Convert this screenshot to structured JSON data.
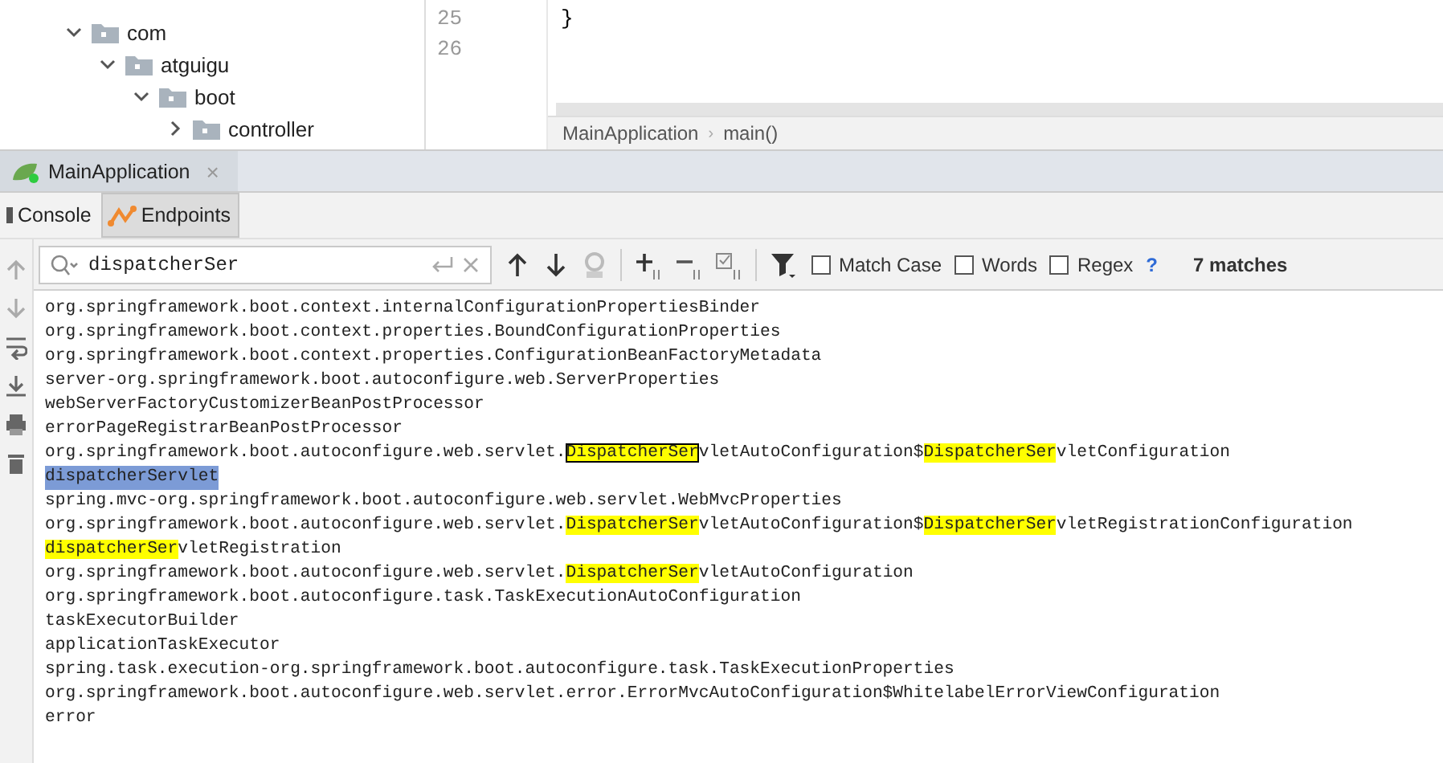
{
  "project_tree": {
    "items": [
      {
        "label": "com",
        "expanded": true,
        "children": [
          {
            "label": "atguigu",
            "expanded": true,
            "children": [
              {
                "label": "boot",
                "expanded": true,
                "children": [
                  {
                    "label": "controller",
                    "expanded": false
                  }
                ]
              }
            ]
          }
        ]
      }
    ]
  },
  "editor": {
    "line_numbers": [
      "25",
      "26"
    ],
    "code_lines": [
      "}"
    ],
    "breadcrumb": [
      "MainApplication",
      "main()"
    ],
    "breadcrumb_separator": "›"
  },
  "run_panel": {
    "tabs": [
      {
        "label": "MainApplication",
        "close": "×",
        "selected": true
      }
    ],
    "sub_tabs": [
      {
        "label": "Console",
        "kind": "console",
        "selected": false
      },
      {
        "label": "Endpoints",
        "kind": "endpoints",
        "selected": true
      }
    ],
    "search": {
      "value": "dispatcherSer",
      "options": [
        {
          "label": "Match Case",
          "checked": false
        },
        {
          "label": "Words",
          "checked": false
        },
        {
          "label": "Regex",
          "checked": false
        }
      ],
      "help": "?",
      "matches": "7 matches"
    },
    "console_lines": [
      {
        "selected": false,
        "segments": [
          {
            "text": "org.springframework.boot.context.internalConfigurationPropertiesBinder",
            "highlighted": false
          }
        ]
      },
      {
        "selected": false,
        "segments": [
          {
            "text": "org.springframework.boot.context.properties.BoundConfigurationProperties",
            "highlighted": false
          }
        ]
      },
      {
        "selected": false,
        "segments": [
          {
            "text": "org.springframework.boot.context.properties.ConfigurationBeanFactoryMetadata",
            "highlighted": false
          }
        ]
      },
      {
        "selected": false,
        "segments": [
          {
            "text": "server-org.springframework.boot.autoconfigure.web.ServerProperties",
            "highlighted": false
          }
        ]
      },
      {
        "selected": false,
        "segments": [
          {
            "text": "webServerFactoryCustomizerBeanPostProcessor",
            "highlighted": false
          }
        ]
      },
      {
        "selected": false,
        "segments": [
          {
            "text": "errorPageRegistrarBeanPostProcessor",
            "highlighted": false
          }
        ]
      },
      {
        "selected": false,
        "segments": [
          {
            "text": "org.springframework.boot.autoconfigure.web.servlet.",
            "highlighted": false
          },
          {
            "text": "DispatcherSer",
            "highlighted": true,
            "current": true
          },
          {
            "text": "vletAutoConfiguration$",
            "highlighted": false
          },
          {
            "text": "DispatcherSer",
            "highlighted": true,
            "current": false
          },
          {
            "text": "vletConfiguration",
            "highlighted": false
          }
        ]
      },
      {
        "selected": true,
        "segments": [
          {
            "text": "dispatcherServlet",
            "highlighted": false
          }
        ]
      },
      {
        "selected": false,
        "segments": [
          {
            "text": "spring.mvc-org.springframework.boot.autoconfigure.web.servlet.WebMvcProperties",
            "highlighted": false
          }
        ]
      },
      {
        "selected": false,
        "segments": [
          {
            "text": "org.springframework.boot.autoconfigure.web.servlet.",
            "highlighted": false
          },
          {
            "text": "DispatcherSer",
            "highlighted": true,
            "current": false
          },
          {
            "text": "vletAutoConfiguration$",
            "highlighted": false
          },
          {
            "text": "DispatcherSer",
            "highlighted": true,
            "current": false
          },
          {
            "text": "vletRegistrationConfiguration",
            "highlighted": false
          }
        ]
      },
      {
        "selected": false,
        "segments": [
          {
            "text": "dispatcherSer",
            "highlighted": true,
            "current": false
          },
          {
            "text": "vletRegistration",
            "highlighted": false
          }
        ]
      },
      {
        "selected": false,
        "segments": [
          {
            "text": "org.springframework.boot.autoconfigure.web.servlet.",
            "highlighted": false
          },
          {
            "text": "DispatcherSer",
            "highlighted": true,
            "current": false
          },
          {
            "text": "vletAutoConfiguration",
            "highlighted": false
          }
        ]
      },
      {
        "selected": false,
        "segments": [
          {
            "text": "org.springframework.boot.autoconfigure.task.TaskExecutionAutoConfiguration",
            "highlighted": false
          }
        ]
      },
      {
        "selected": false,
        "segments": [
          {
            "text": "taskExecutorBuilder",
            "highlighted": false
          }
        ]
      },
      {
        "selected": false,
        "segments": [
          {
            "text": "applicationTaskExecutor",
            "highlighted": false
          }
        ]
      },
      {
        "selected": false,
        "segments": [
          {
            "text": "spring.task.execution-org.springframework.boot.autoconfigure.task.TaskExecutionProperties",
            "highlighted": false
          }
        ]
      },
      {
        "selected": false,
        "segments": [
          {
            "text": "org.springframework.boot.autoconfigure.web.servlet.error.ErrorMvcAutoConfiguration$WhitelabelErrorViewConfiguration",
            "highlighted": false
          }
        ]
      },
      {
        "selected": false,
        "segments": [
          {
            "text": "error",
            "highlighted": false
          }
        ]
      }
    ]
  }
}
